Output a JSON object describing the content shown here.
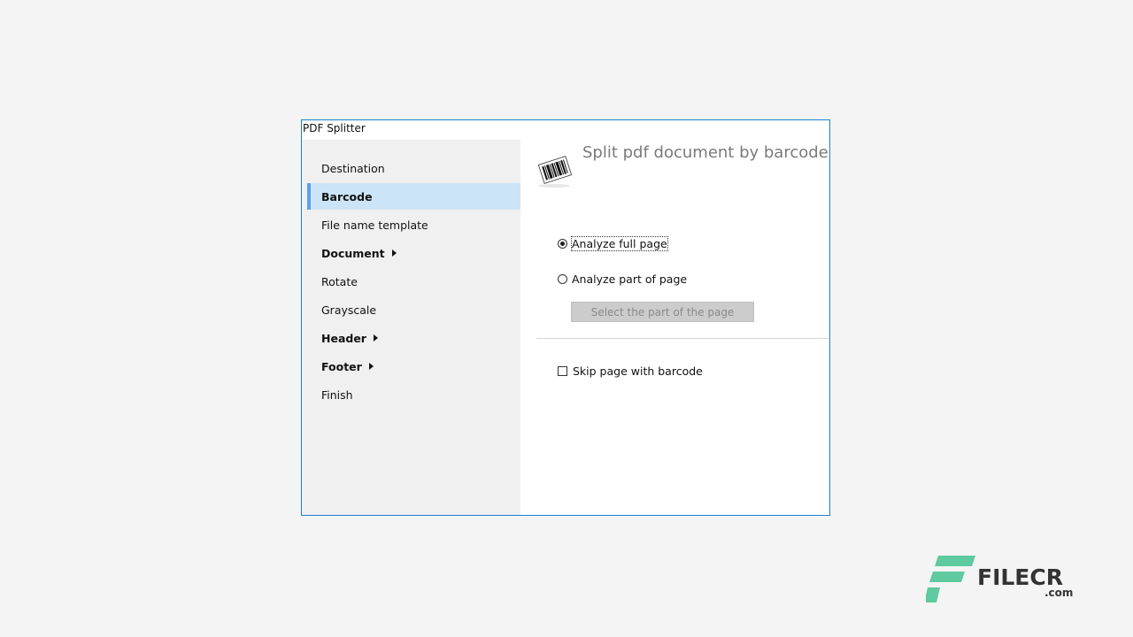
{
  "window": {
    "title": "PDF Splitter"
  },
  "sidebar": {
    "items": [
      {
        "label": "Destination"
      },
      {
        "label": "Barcode"
      },
      {
        "label": "File name template"
      },
      {
        "label": "Document"
      },
      {
        "label": "Rotate"
      },
      {
        "label": "Grayscale"
      },
      {
        "label": "Header"
      },
      {
        "label": "Footer"
      },
      {
        "label": "Finish"
      }
    ],
    "selected": "Barcode"
  },
  "content": {
    "heading": "Split pdf document by barcode",
    "heading_icon": "barcode-icon",
    "options": {
      "full_page": "Analyze full page",
      "part_page": "Analyze part of page",
      "selected": "Analyze full page"
    },
    "select_part_button": "Select the part of the page",
    "skip_checkbox": {
      "label": "Skip page with barcode",
      "checked": false
    }
  },
  "watermark": {
    "brand": "FILECR",
    "domain": ".com",
    "color": "#5fc9a0"
  },
  "colors": {
    "accent": "#1a7fd0",
    "selected_bg": "#cce4f7",
    "selected_bar": "#5aa2e2"
  }
}
